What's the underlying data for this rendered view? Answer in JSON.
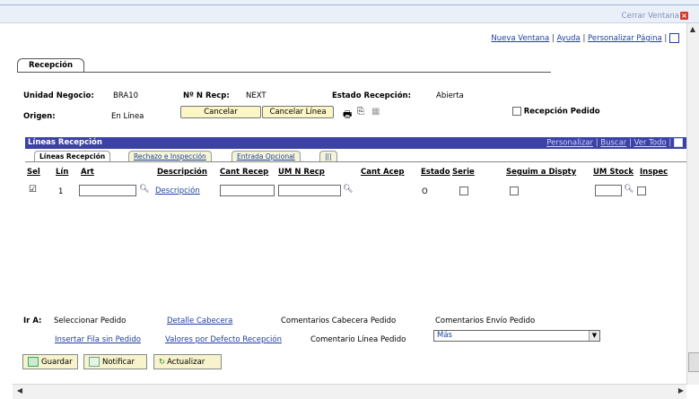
{
  "window": {
    "close_label": "Cerrar Ventana",
    "close_icon": "x",
    "top_links": [
      "Nueva Ventana",
      "Ayuda",
      "Personalizar Página"
    ]
  },
  "page": {
    "tab_label": "Recepción",
    "unidad_negocio_label": "Unidad Negocio:",
    "unidad_negocio_value": "BRA10",
    "nrecp_label": "Nº N Recp:",
    "nrecp_value": "NEXT",
    "estado_label": "Estado Recepción:",
    "estado_value": "Abierta",
    "origen_label": "Origen:",
    "origen_value": "En Línea",
    "cancelar_label": "Cancelar",
    "cancelar_linea_label": "Cancelar Línea",
    "recepcion_pedido_label": "Recepción Pedido"
  },
  "grid": {
    "title": "Líneas Recepción",
    "tools": [
      "Personalizar",
      "Buscar",
      "Ver Todo"
    ],
    "tabs": [
      "Líneas Recepción",
      "Rechazo e Inspección",
      "Entrada Opcional"
    ],
    "tab_more": "|||",
    "columns": [
      "Sel",
      "Lín",
      "Art",
      "Descripción",
      "Cant Recep",
      "UM N Recp",
      "Cant Acep",
      "Estado",
      "Serie",
      "Seguim a Dispty",
      "UM Stock",
      "Inspec"
    ],
    "row": {
      "lin": "1",
      "descripcion_link": "Descripción",
      "estado": "O"
    }
  },
  "ir_a": {
    "label": "Ir A:",
    "seleccionar_pedido": "Seleccionar Pedido",
    "detalle_cabecera": "Detalle Cabecera",
    "comentarios_cabecera": "Comentarios Cabecera Pedido",
    "comentarios_envio": "Comentarios Envío Pedido",
    "insertar_fila": "Insertar Fila sin Pedido",
    "valores_defecto": "Valores por Defecto Recepción",
    "comentario_linea": "Comentario Línea Pedido",
    "mas_select": "Más"
  },
  "footer": {
    "guardar": "Guardar",
    "notificar": "Notificar",
    "actualizar": "Actualizar"
  }
}
